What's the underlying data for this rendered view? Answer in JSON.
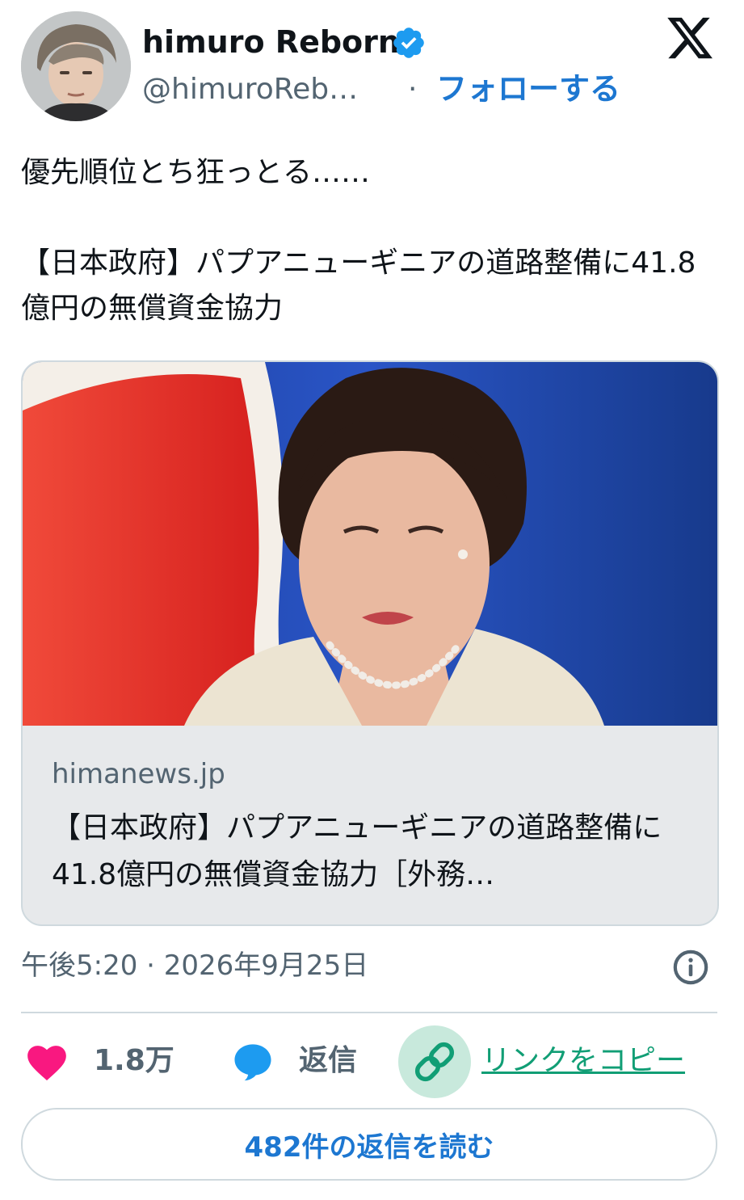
{
  "author": {
    "display_name": "himuro Reborn",
    "handle": "@himuroReb…",
    "follow_label": "フォローする",
    "separator": "·"
  },
  "tweet": {
    "text": "優先順位とち狂っとる……\n\n【日本政府】パプアニューギニアの道路整備に41.8億円の無償資金協力"
  },
  "card": {
    "domain": "himanews.jp",
    "title": "【日本政府】パプアニューギニアの道路整備に41.8億円の無償資金協力［外務…"
  },
  "meta": {
    "timestamp": "午後5:20 · 2026年9月25日"
  },
  "actions": {
    "like_count": "1.8万",
    "reply_label": "返信",
    "copy_link_label": "リンクをコピー",
    "read_replies_label": "482件の返信を読む"
  },
  "icons": {
    "verified": "verified-badge-icon",
    "logo": "x-logo-icon",
    "info": "info-icon",
    "like": "heart-icon",
    "reply": "speech-bubble-icon",
    "link": "link-icon"
  },
  "colors": {
    "accent_blue": "#1d77d1",
    "like_pink": "#f91880",
    "reply_blue": "#1d9bf0",
    "link_green": "#119e75",
    "secondary_text": "#536471"
  }
}
